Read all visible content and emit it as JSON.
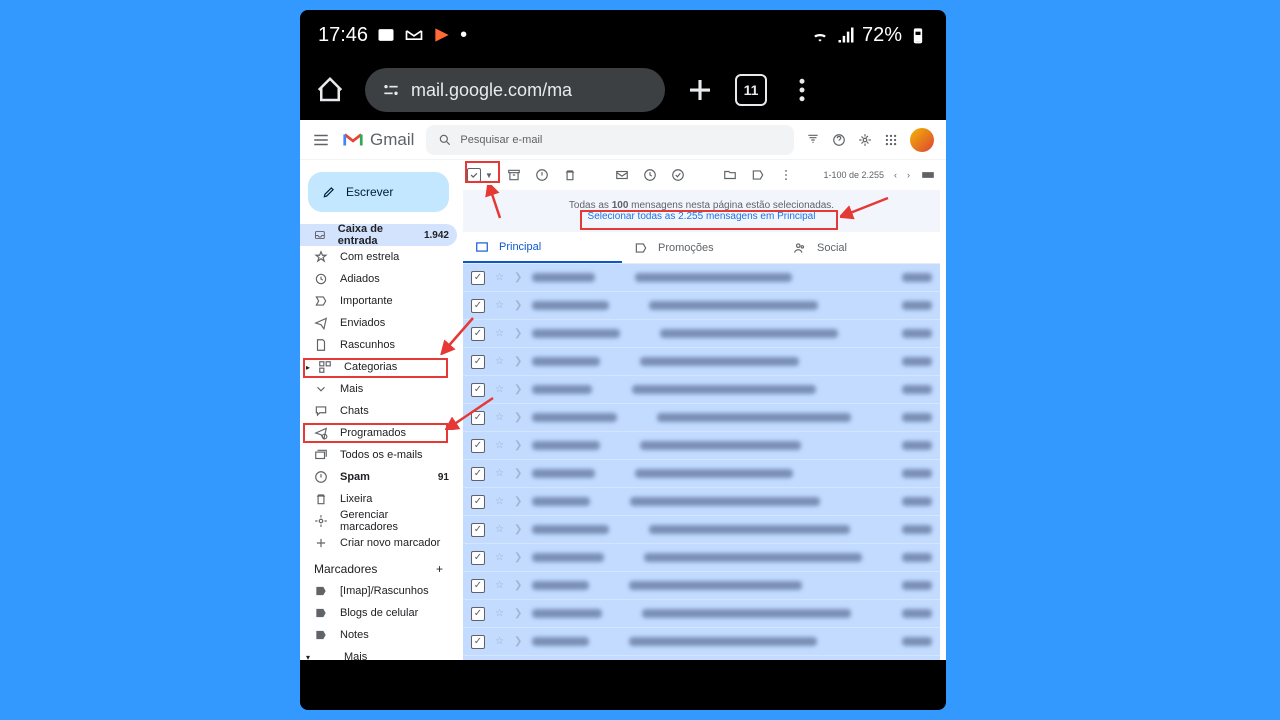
{
  "status_bar": {
    "time": "17:46",
    "battery": "72%"
  },
  "browser": {
    "url": "mail.google.com/ma",
    "tab_count": "11"
  },
  "gmail": {
    "logo_text": "Gmail",
    "search_placeholder": "Pesquisar e-mail",
    "compose": "Escrever",
    "sidebar": [
      {
        "icon": "inbox",
        "label": "Caixa de entrada",
        "count": "1.942",
        "active": true
      },
      {
        "icon": "star",
        "label": "Com estrela"
      },
      {
        "icon": "snooze",
        "label": "Adiados"
      },
      {
        "icon": "important",
        "label": "Importante"
      },
      {
        "icon": "sent",
        "label": "Enviados"
      },
      {
        "icon": "draft",
        "label": "Rascunhos"
      },
      {
        "icon": "category",
        "label": "Categorias",
        "expand": true
      },
      {
        "icon": "less",
        "label": "Mais"
      },
      {
        "icon": "chat",
        "label": "Chats"
      },
      {
        "icon": "scheduled",
        "label": "Programados"
      },
      {
        "icon": "allmail",
        "label": "Todos os e-mails"
      },
      {
        "icon": "spam",
        "label": "Spam",
        "count": "91",
        "bold": true
      },
      {
        "icon": "trash",
        "label": "Lixeira"
      },
      {
        "icon": "settings",
        "label": "Gerenciar marcadores"
      },
      {
        "icon": "plus",
        "label": "Criar novo marcador"
      }
    ],
    "labels_header": "Marcadores",
    "labels": [
      {
        "label": "[Imap]/Rascunhos"
      },
      {
        "label": "Blogs de celular"
      },
      {
        "label": "Notes"
      },
      {
        "label": "Mais",
        "expand": true
      }
    ],
    "pagination": "1-100 de 2.255",
    "banner_text_1": "Todas as ",
    "banner_count": "100",
    "banner_text_2": " mensagens nesta página estão selecionadas.",
    "banner_link": "Selecionar todas as 2.255 mensagens em Principal",
    "tabs": [
      {
        "label": "Principal",
        "active": true
      },
      {
        "label": "Promoções"
      },
      {
        "label": "Social"
      }
    ]
  }
}
